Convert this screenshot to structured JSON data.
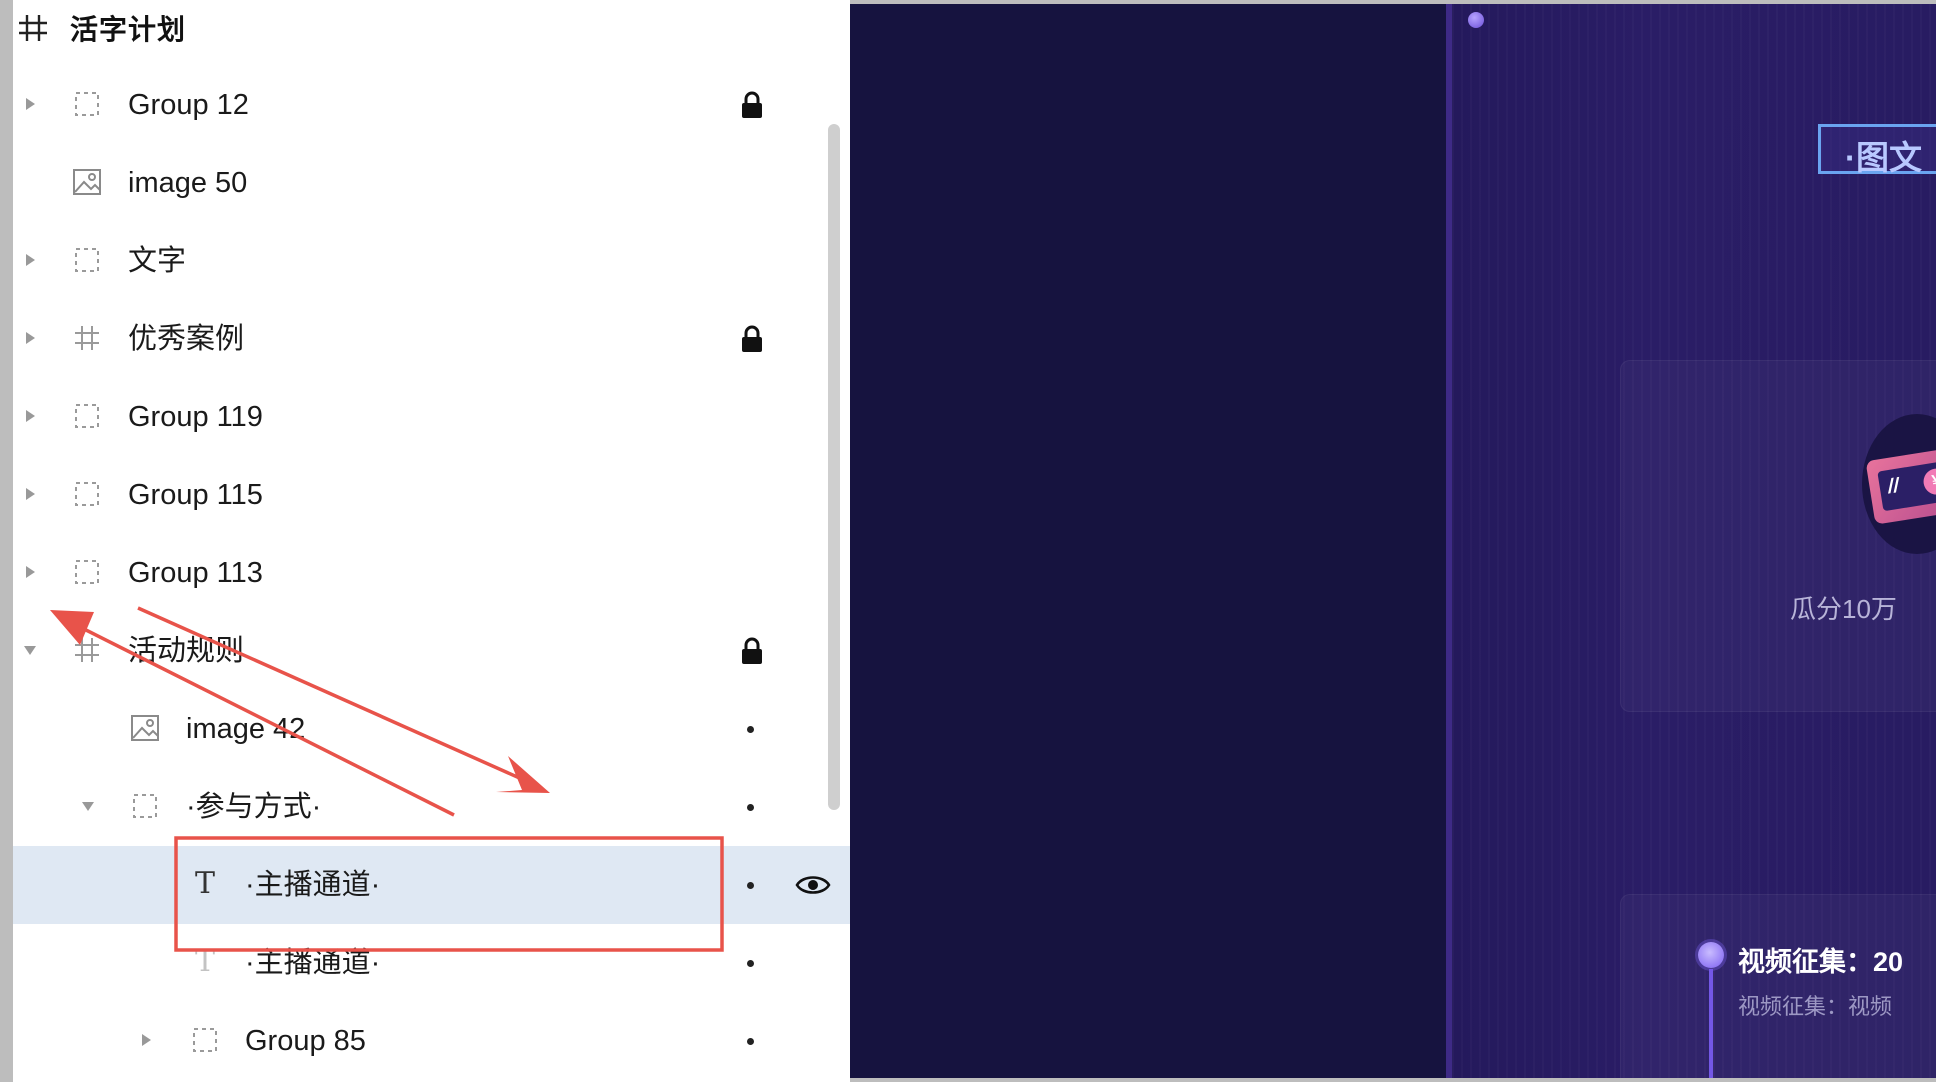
{
  "layers_panel": {
    "frame_title": "活字计划",
    "rows": [
      {
        "label": "Group 12"
      },
      {
        "label": "image 50"
      },
      {
        "label": "文字"
      },
      {
        "label": "优秀案例"
      },
      {
        "label": "Group 119"
      },
      {
        "label": "Group 115"
      },
      {
        "label": "Group 113"
      },
      {
        "label": "活动规则"
      },
      {
        "label": "image 42"
      },
      {
        "label": "·参与方式·"
      },
      {
        "label": "·主播通道·"
      },
      {
        "label": "·主播通道·"
      },
      {
        "label": "Group 85"
      }
    ]
  },
  "canvas": {
    "section_title": "·图文",
    "prize_text": "瓜分10万",
    "ticket_slashes": "//",
    "ticket_coin": "¥",
    "timeline_title": "视频征集：20",
    "timeline_sub": "视频征集：视频"
  },
  "colors": {
    "selection_bg": "#dfe8f3",
    "annotation_red": "#e8534a",
    "canvas_bg": "#16133f",
    "artboard_bg": "#281c62"
  }
}
